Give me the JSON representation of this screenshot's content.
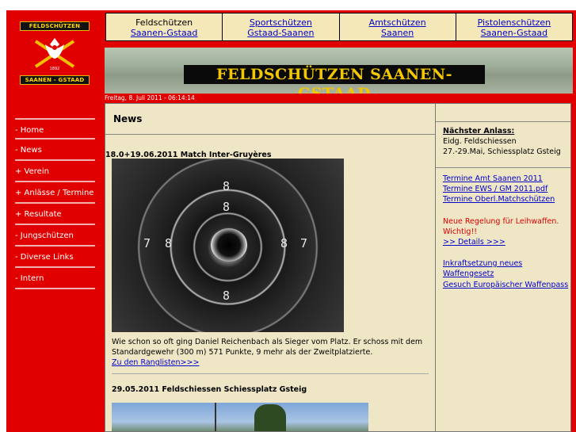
{
  "logo": {
    "top_text": "FELDSCHÜTZEN",
    "bottom_text": "SAANEN - GSTAAD",
    "year": "1892"
  },
  "topnav": [
    {
      "line1": "Feldschützen",
      "line2": "Saanen-Gstaad"
    },
    {
      "line1": "Sportschützen",
      "line2": "Gstaad-Saanen"
    },
    {
      "line1": "Amtschützen",
      "line2": "Saanen"
    },
    {
      "line1": "Pistolenschützen",
      "line2": "Saanen-Gstaad"
    }
  ],
  "banner": {
    "title": "FELDSCHÜTZEN SAANEN-GSTAAD"
  },
  "date": "Freitag, 8. Juli 2011 - 06:14:14",
  "menu": [
    " - Home",
    " - News",
    "+ Verein",
    "+ Anlässe / Termine",
    "+ Resultate",
    " - Jungschützen",
    " - Diverse Links",
    " - Intern"
  ],
  "main": {
    "heading": "News",
    "news": [
      {
        "title": "18.0+19.06.2011 Match Inter-Gruyères",
        "text1": "Wie schon so oft ging Daniel Reichenbach als Sieger vom Platz. Er schoss mit dem",
        "text2": "Standardgewehr (300 m) 571 Punkte, 9 mehr als der Zweitplatzierte.",
        "link": "Zu den Ranglisten>>>"
      },
      {
        "title": "29.05.2011 Feldschiessen Schiessplatz Gsteig"
      }
    ],
    "target_numbers": [
      "8",
      "8",
      "7",
      "8",
      "8",
      "7",
      "8"
    ]
  },
  "side": {
    "next_label": "Nächster Anlass:",
    "next_event": "Eidg. Feldschiessen",
    "next_detail": "27.-29.Mai, Schiessplatz Gsteig",
    "links1": [
      "Termine Amt Saanen 2011",
      "Termine EWS / GM 2011.pdf",
      "Termine Oberl.Matchschützen"
    ],
    "notice1": "Neue Regelung für Leihwaffen.",
    "notice2": "Wichtig!!",
    "details_link": ">> Details >>>",
    "link_law": "Inkraftsetzung neues Waffengesetz",
    "link_pass": "Gesuch Europäischer Waffenpass"
  },
  "colors": {
    "frame": "#e00000",
    "panel": "#efe6c6",
    "nav": "#f4e8b8",
    "link": "#0000cc",
    "banner_text": "#f2c700"
  }
}
